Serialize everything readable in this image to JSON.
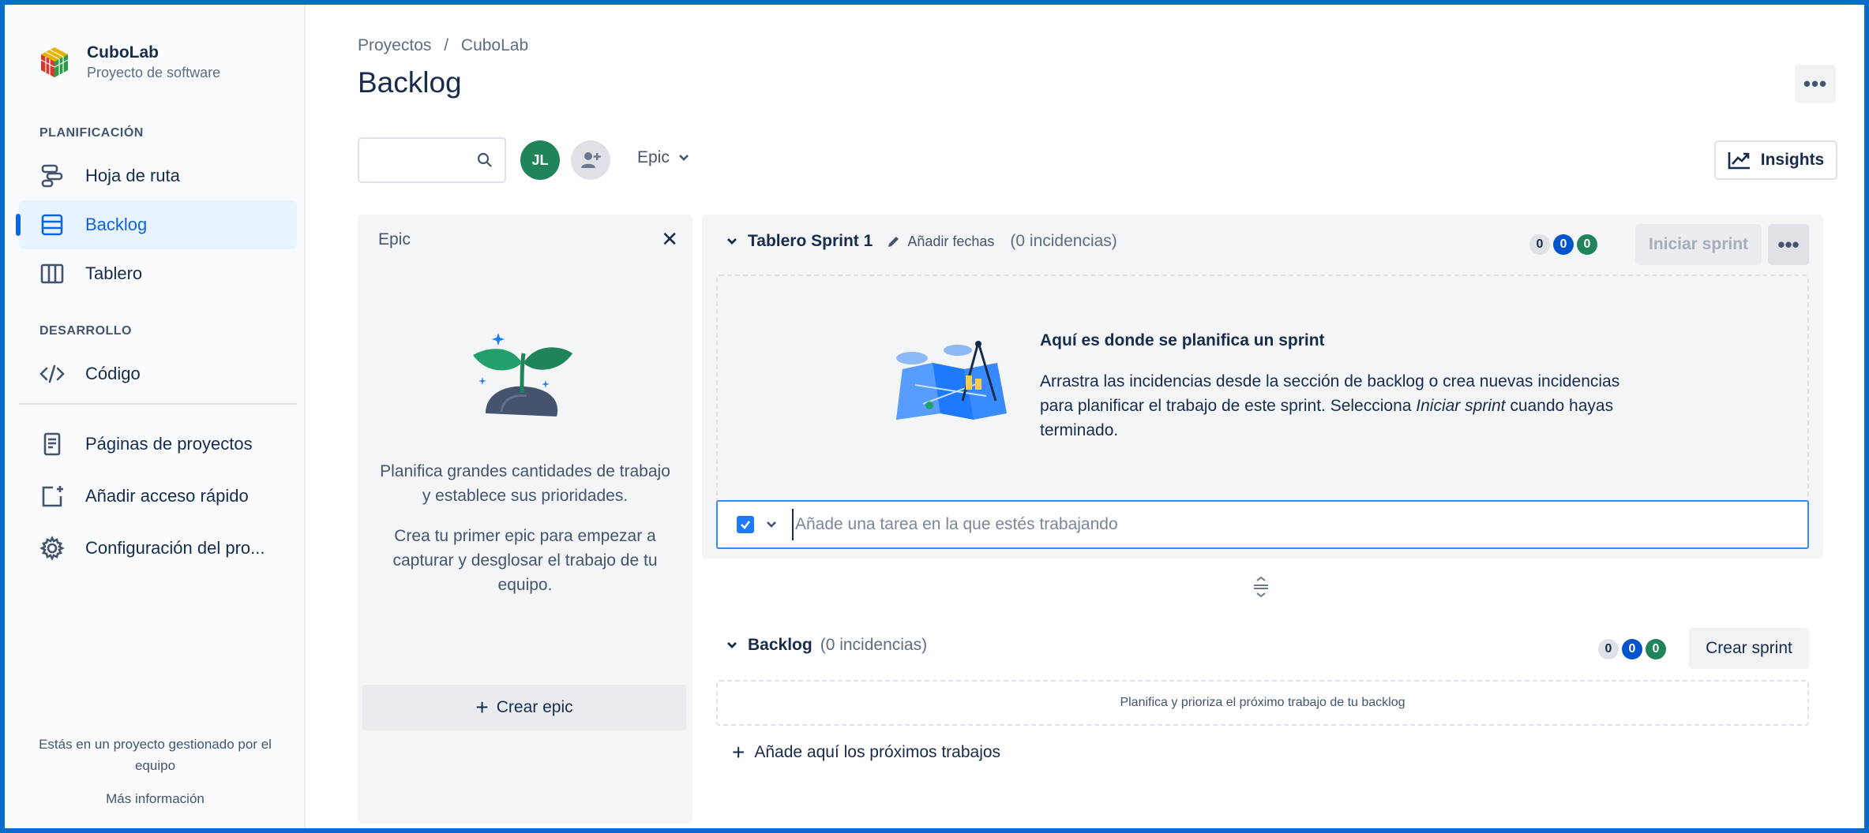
{
  "sidebar": {
    "project_name": "CuboLab",
    "project_type": "Proyecto de software",
    "section_planning": "PLANIFICACIÓN",
    "section_dev": "DESARROLLO",
    "items": [
      {
        "label": "Hoja de ruta",
        "icon": "roadmap-icon"
      },
      {
        "label": "Backlog",
        "icon": "backlog-icon",
        "active": true
      },
      {
        "label": "Tablero",
        "icon": "board-icon"
      },
      {
        "label": "Código",
        "icon": "code-icon"
      },
      {
        "label": "Páginas de proyectos",
        "icon": "pages-icon"
      },
      {
        "label": "Añadir acceso rápido",
        "icon": "shortcut-icon"
      },
      {
        "label": "Configuración del pro...",
        "icon": "gear-icon"
      }
    ],
    "footer_text": "Estás en un proyecto gestionado por el equipo",
    "footer_link": "Más información"
  },
  "header": {
    "breadcrumb": [
      "Proyectos",
      "/",
      "CuboLab"
    ],
    "title": "Backlog",
    "more": "•••"
  },
  "toolbar": {
    "search_placeholder": "",
    "avatar_initials": "JL",
    "epic_filter": "Epic",
    "insights": "Insights"
  },
  "epic_panel": {
    "title": "Epic",
    "close": "✕",
    "text1": "Planifica grandes cantidades de trabajo y establece sus prioridades.",
    "text2": "Crea tu primer epic para empezar a capturar y desglosar el trabajo de tu equipo.",
    "create": "Crear epic"
  },
  "sprint": {
    "name": "Tablero Sprint 1",
    "add_dates": "Añadir fechas",
    "count": "(0 incidencias)",
    "badges": [
      "0",
      "0",
      "0"
    ],
    "start": "Iniciar sprint",
    "more": "•••",
    "empty_title": "Aquí es donde se planifica un sprint",
    "empty_body_1": "Arrastra las incidencias desde la sección de backlog o crea nuevas incidencias para planificar el trabajo de este sprint. Selecciona ",
    "empty_body_em": "Iniciar sprint",
    "empty_body_2": " cuando hayas terminado.",
    "create_placeholder": "Añade una tarea en la que estés trabajando"
  },
  "backlog": {
    "name": "Backlog",
    "count": "(0 incidencias)",
    "badges": [
      "0",
      "0",
      "0"
    ],
    "create_sprint": "Crear sprint",
    "empty": "Planifica y prioriza el próximo trabajo de tu backlog",
    "add_next": "Añade aquí los próximos trabajos"
  },
  "colors": {
    "accent": "#0c66e4",
    "frame": "#0a6cc9",
    "badge_blue": "#0055cc",
    "badge_green": "#1f845a"
  }
}
